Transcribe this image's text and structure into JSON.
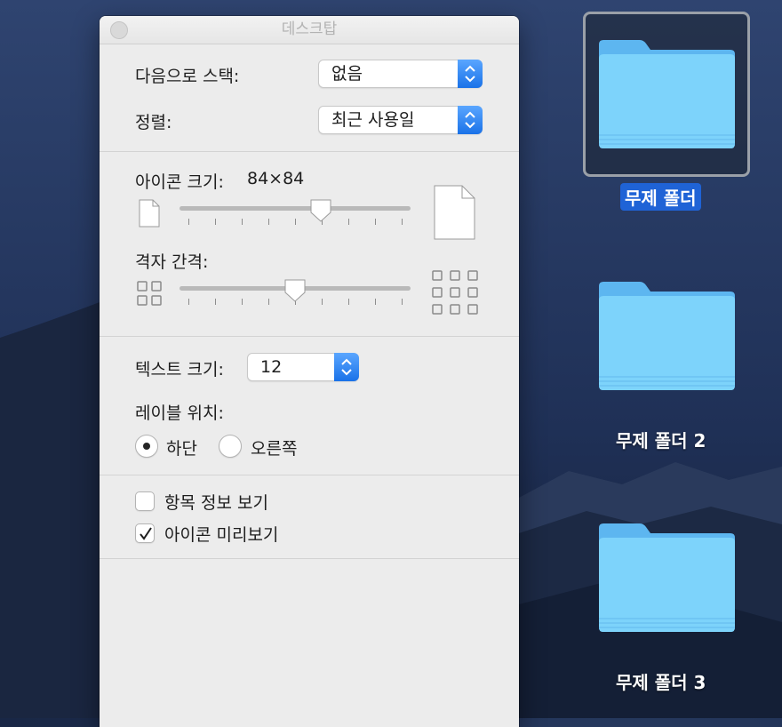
{
  "panel": {
    "title": "데스크탑",
    "stack_by": {
      "label": "다음으로 스택:",
      "value": "없음"
    },
    "sort_by": {
      "label": "정렬:",
      "value": "최근 사용일"
    },
    "icon_size": {
      "label": "아이콘 크기:",
      "value": "84×84",
      "slider_fraction": 0.61
    },
    "grid_spacing": {
      "label": "격자 간격:",
      "slider_fraction": 0.5
    },
    "text_size": {
      "label": "텍스트 크기:",
      "value": "12"
    },
    "label_position": {
      "label": "레이블 위치:",
      "options": [
        {
          "label": "하단",
          "selected": true
        },
        {
          "label": "오른쪽",
          "selected": false
        }
      ]
    },
    "show_item_info": {
      "label": "항목 정보 보기",
      "checked": false
    },
    "show_icon_preview": {
      "label": "아이콘 미리보기",
      "checked": true
    }
  },
  "desktop": {
    "folders": [
      {
        "name": "무제 폴더",
        "selected": true,
        "icon": "folder-icon"
      },
      {
        "name": "무제 폴더 2",
        "selected": false,
        "icon": "folder-icon"
      },
      {
        "name": "무제 폴더 3",
        "selected": false,
        "icon": "folder-icon"
      }
    ]
  },
  "colors": {
    "accent": "#1a72e8",
    "folder": "#6ec8f8",
    "selection": "#1f63d6"
  }
}
